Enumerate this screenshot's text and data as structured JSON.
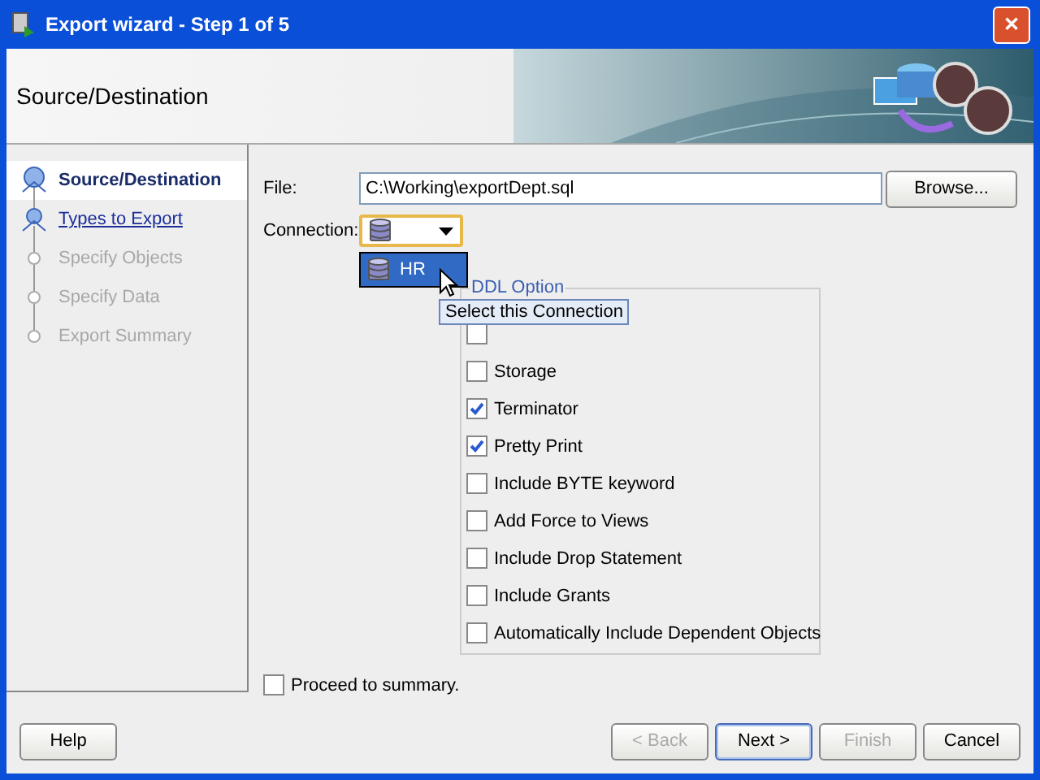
{
  "window": {
    "title": "Export wizard - Step 1 of 5",
    "close": "✕"
  },
  "header": {
    "title": "Source/Destination"
  },
  "steps": [
    {
      "label": "Source/Destination",
      "current": true,
      "disabled": false
    },
    {
      "label": "Types to Export",
      "current": false,
      "disabled": false
    },
    {
      "label": "Specify Objects",
      "current": false,
      "disabled": true
    },
    {
      "label": "Specify Data",
      "current": false,
      "disabled": true
    },
    {
      "label": "Export Summary",
      "current": false,
      "disabled": true
    }
  ],
  "file": {
    "label": "File:",
    "value": "C:\\Working\\exportDept.sql",
    "browse": "Browse..."
  },
  "connection": {
    "label": "Connection:",
    "options": [
      {
        "label": "HR",
        "selected": true
      }
    ],
    "tooltip": "Select this Connection"
  },
  "ddl": {
    "legend": "DDL Option",
    "options": [
      {
        "checked": false
      },
      {
        "label": "Storage",
        "checked": false
      },
      {
        "label": "Terminator",
        "checked": true
      },
      {
        "label": "Pretty Print",
        "checked": true
      },
      {
        "label": "Include BYTE keyword",
        "checked": false
      },
      {
        "label": "Add Force to Views",
        "checked": false
      },
      {
        "label": "Include Drop Statement",
        "checked": false
      },
      {
        "label": "Include Grants",
        "checked": false
      },
      {
        "label": "Automatically Include Dependent Objects",
        "checked": false
      }
    ]
  },
  "proceed": {
    "label": "Proceed to summary.",
    "checked": false
  },
  "buttons": [
    {
      "label": "Help",
      "disabled": false,
      "default": false
    },
    {
      "label": "< Back",
      "disabled": true,
      "default": false
    },
    {
      "label": "Next >",
      "disabled": false,
      "default": true
    },
    {
      "label": "Finish",
      "disabled": true,
      "default": false
    },
    {
      "label": "Cancel",
      "disabled": false,
      "default": false
    }
  ]
}
